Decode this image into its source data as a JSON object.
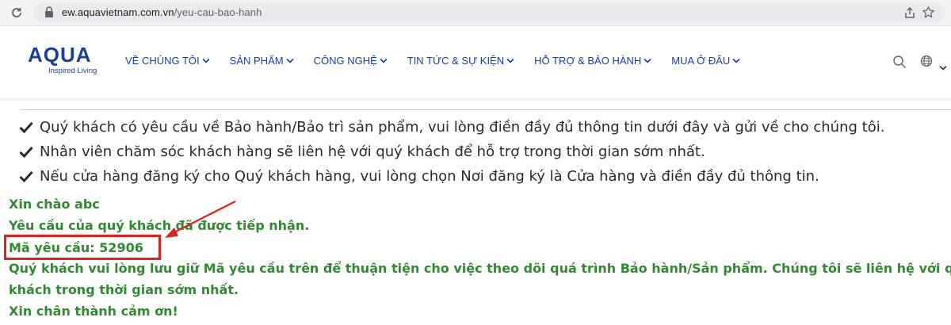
{
  "browser": {
    "url_host": "ew.aquavietnam.com.vn",
    "url_path": "/yeu-cau-bao-hanh"
  },
  "header": {
    "logo_text": "AQUA",
    "logo_tagline": "Inspired Living",
    "nav": [
      {
        "label": "VỀ CHÚNG TÔI"
      },
      {
        "label": "SẢN PHẨM"
      },
      {
        "label": "CÔNG NGHỆ"
      },
      {
        "label": "TIN TỨC & SỰ KIỆN"
      },
      {
        "label": "HỖ TRỢ & BẢO HÀNH"
      },
      {
        "label": "MUA Ở ĐÂU"
      }
    ]
  },
  "intro": [
    "Quý khách có yêu cầu về Bảo hành/Bảo trì sản phẩm, vui lòng điền đầy đủ thông tin dưới đây và gửi về cho chúng tôi.",
    "Nhân viên chăm sóc khách hàng sẽ liên hệ với quý khách để hỗ trợ trong thời gian sớm nhất.",
    "Nếu cửa hàng đăng ký cho Quý khách hàng, vui lòng chọn Nơi đăng ký là Cửa hàng và điền đầy đủ thông tin."
  ],
  "result": {
    "greeting": "Xin chào abc",
    "received": "Yêu cầu của quý khách đã được tiếp nhận.",
    "request_code": "Mã yêu cầu: 52906",
    "note_line1": "Quý khách vui lòng lưu giữ Mã yêu cầu trên để thuận tiện cho việc theo dõi quá trình Bảo hành/Sản phẩm. Chúng tôi sẽ liên hệ với quý",
    "note_line2": "khách trong thời gian sớm nhất.",
    "thanks": "Xin chân thành cảm ơn!"
  },
  "colors": {
    "brand": "#1a3f96",
    "success_text": "#2e8b2e",
    "annotation": "#e02020"
  }
}
